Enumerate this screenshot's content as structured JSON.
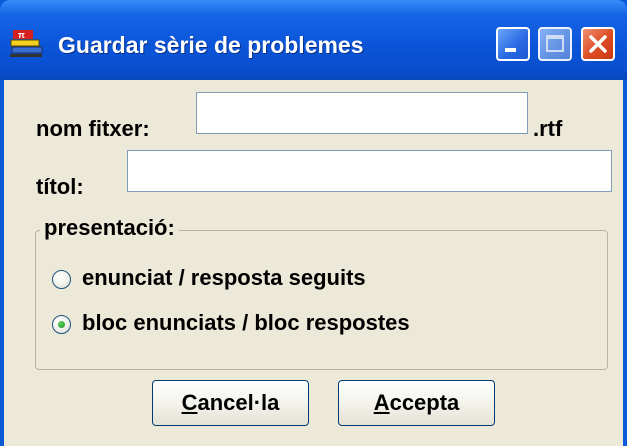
{
  "window": {
    "title": "Guardar sèrie de problemes",
    "icon": "app-books-icon",
    "controls": {
      "minimize": "minimize-icon",
      "maximize": "maximize-icon",
      "close": "close-icon"
    }
  },
  "form": {
    "filename_label": "nom fitxer:",
    "filename_value": "",
    "filename_ext": ".rtf",
    "title_label": "títol:",
    "title_value": ""
  },
  "presentation": {
    "legend": "presentació:",
    "options": [
      {
        "label": "enunciat / resposta seguits",
        "checked": false
      },
      {
        "label": "bloc enunciats / bloc respostes",
        "checked": true
      }
    ]
  },
  "buttons": {
    "cancel_mnemonic": "C",
    "cancel_rest": "ancel·la",
    "accept_mnemonic": "A",
    "accept_rest": "ccepta"
  },
  "colors": {
    "titlebar": "#0b55d9",
    "dialog_bg": "#ece9d8",
    "close": "#dd4b23"
  }
}
